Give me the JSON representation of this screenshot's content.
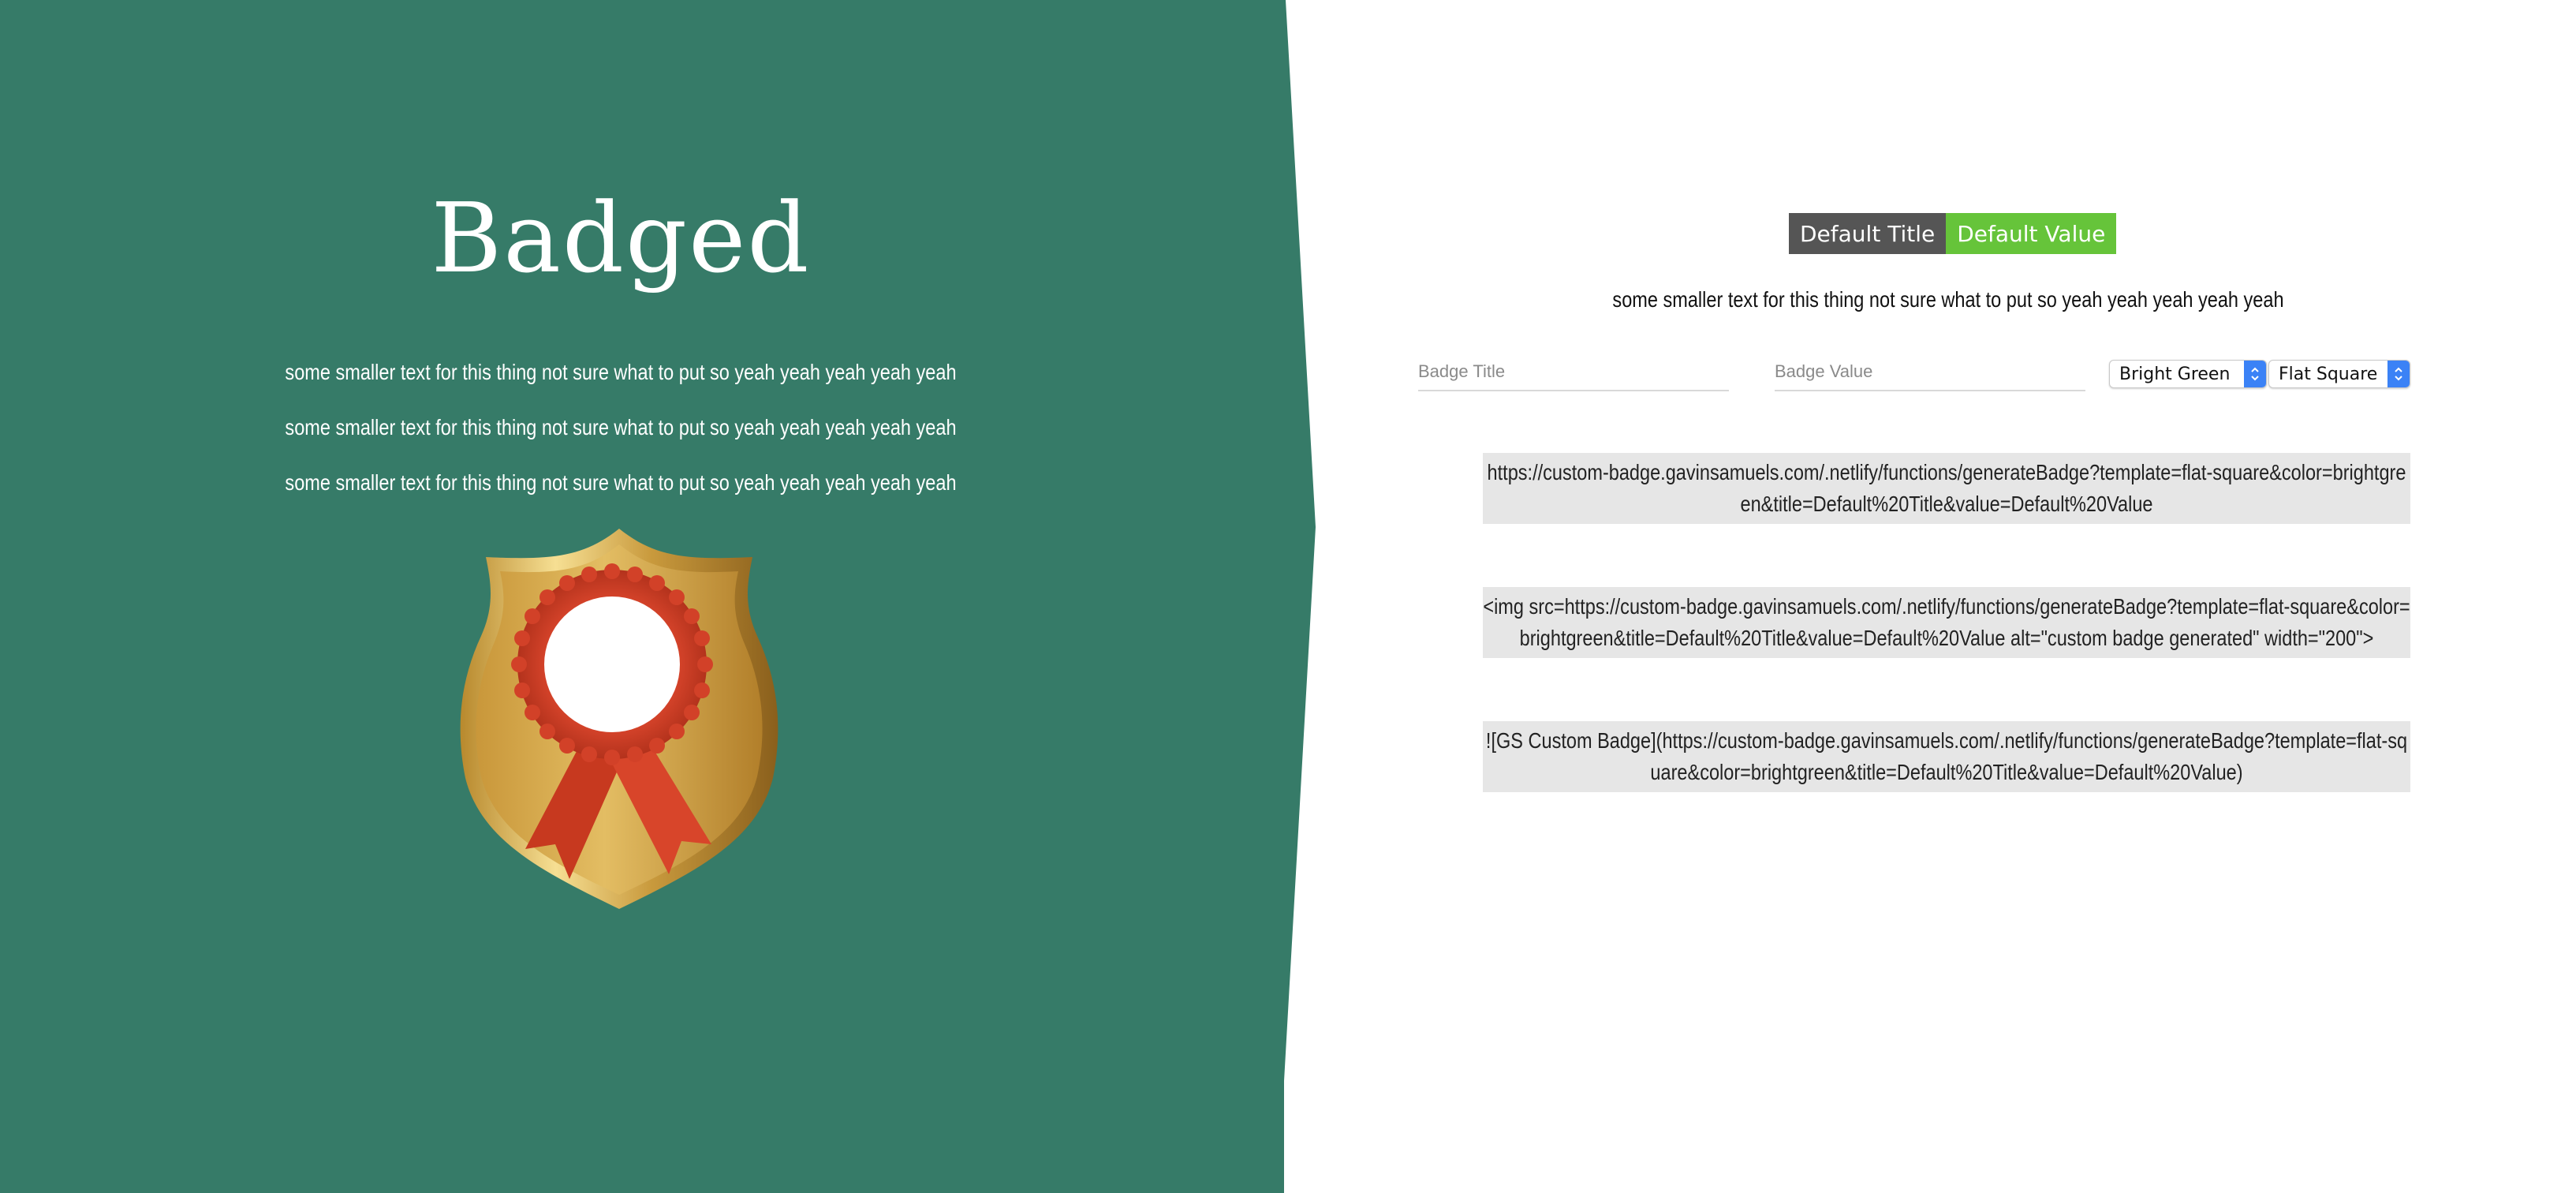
{
  "hero": {
    "title": "Badged",
    "lines": [
      "some smaller text for this thing not sure what to put so yeah yeah yeah yeah yeah",
      "some smaller text for this thing not sure what to put so yeah yeah yeah yeah yeah",
      "some smaller text for this thing not sure what to put so yeah yeah yeah yeah yeah"
    ],
    "background_color": "#367b68"
  },
  "preview": {
    "title": "Default Title",
    "value": "Default Value",
    "title_color": "#555555",
    "value_color": "#66c43a"
  },
  "form": {
    "subtitle": "some smaller text for this thing not sure what to put so yeah yeah yeah yeah yeah",
    "title_placeholder": "Badge Title",
    "value_placeholder": "Badge Value",
    "color_select": "Bright Green",
    "template_select": "Flat Square"
  },
  "outputs": {
    "url": "https://custom-badge.gavinsamuels.com/.netlify/functions/generateBadge?template=flat-square&color=brightgreen&title=Default%20Title&value=Default%20Value",
    "html": "<img src=https://custom-badge.gavinsamuels.com/.netlify/functions/generateBadge?template=flat-square&color=brightgreen&title=Default%20Title&value=Default%20Value alt=\"custom badge generated\" width=\"200\">",
    "markdown": "![GS Custom Badge](https://custom-badge.gavinsamuels.com/.netlify/functions/generateBadge?template=flat-square&color=brightgreen&title=Default%20Title&value=Default%20Value)"
  }
}
